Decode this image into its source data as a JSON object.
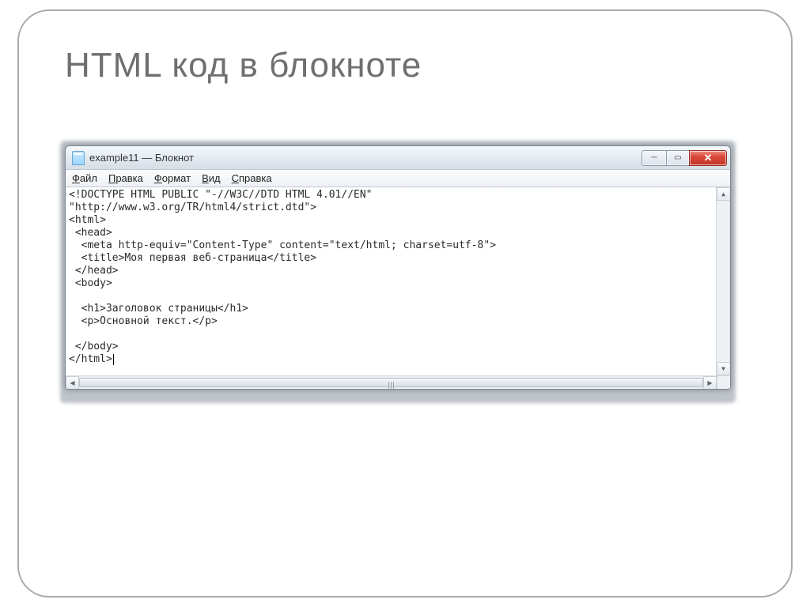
{
  "slide": {
    "title": "HTML код  в блокноте"
  },
  "window": {
    "title": "example11 — Блокнот"
  },
  "menubar": {
    "file_pre": "Ф",
    "file_rest": "айл",
    "edit_pre": "П",
    "edit_rest": "равка",
    "format_pre": "Ф",
    "format_rest": "ормат",
    "view_pre": "В",
    "view_rest": "ид",
    "help_pre": "С",
    "help_rest": "правка"
  },
  "content": {
    "line1": "<!DOCTYPE HTML PUBLIC \"-//W3C//DTD HTML 4.01//EN\"",
    "line2": "\"http://www.w3.org/TR/html4/strict.dtd\">",
    "line3": "<html>",
    "line4": " <head>",
    "line5": "  <meta http-equiv=\"Content-Type\" content=\"text/html; charset=utf-8\">",
    "line6": "  <title>Моя первая веб-страница</title>",
    "line7": " </head>",
    "line8": " <body>",
    "line9": "",
    "line10": "  <h1>Заголовок страницы</h1>",
    "line11": "  <p>Основной текст.</p>",
    "line12": "",
    "line13": " </body>",
    "line14": "</html>"
  }
}
